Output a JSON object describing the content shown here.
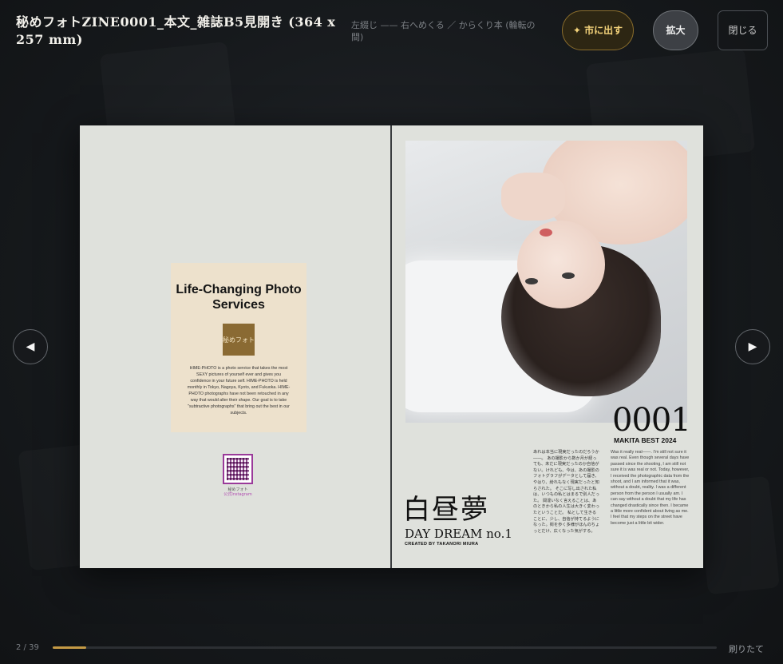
{
  "header": {
    "title": "秘めフォトZINE0001_本文_雑誌B5見開き (364 x 257 mm)",
    "subtitle": "左綴じ —— 右へめくる ／ からくり本 (輪転の間)",
    "publish_label": "✦ 市に出す",
    "zoom_label": "拡大",
    "close_label": "閉じる"
  },
  "nav": {
    "prev": "◀",
    "next": "▶"
  },
  "left_page": {
    "ad_title": "Life-Changing Photo Services",
    "logo_text": "秘めフォト",
    "ad_body": "HIME-PHOTO is a photo service that takes the most SEXY pictures of yourself ever and gives you confidence in your future self. HIME-PHOTO is held monthly in Tokyo, Nagoya, Kyoto, and Fukuoka. HIME-PHOTO photographs have not been retouched in any way that would alter their shape. Our goal is to take \"subtractive photographs\" that bring out the best in our subjects.",
    "qr_label": "秘めフォト",
    "qr_sub": "公式Instagram"
  },
  "right_page": {
    "issue_no": "0001",
    "issue_sub": "MAKITA BEST 2024",
    "jp_title": "白昼夢",
    "en_title": "DAY DREAM no.1",
    "credit": "CREATED BY TAKANORI MIURA",
    "jp_text": "あれは本当に現実だったのだろうか――。 あの撮影から数か月が経っても、未だに現実だったのか自信がない。けれども、今は、あの撮影のフォトグラフがデータとして届き、やはり、紛れもなく現実だったと知らされた。 そこに写し出された私は、いつもの私とはまるで別人だった。 間違いなく言えることは、あのときから私の人生は大きく変わったということだ。 私として生きることに、少し、自信が持てるようになった。街を歩く多様がほんのちょっとだけ、広くなった気がする。",
    "en_text": "Was it really real――. I'm still not sure it was real. Even though several days have passed since the shooting, I am still not sure it is was real or not. Today, however, I received the photographic data from the shoot, and I am informed that it was, without a doubt, reality. I was a different person from the person I usually am. I can say without a doubt that my life has changed drastically since then. I became a little more confident about living as me. I feel that my steps on the street have become just a little bit wider."
  },
  "footer": {
    "page_count": "2 / 39",
    "progress": 0.05,
    "label": "刷りたて"
  },
  "colors": {
    "accent": "#c49a45",
    "background": "#15181b"
  }
}
